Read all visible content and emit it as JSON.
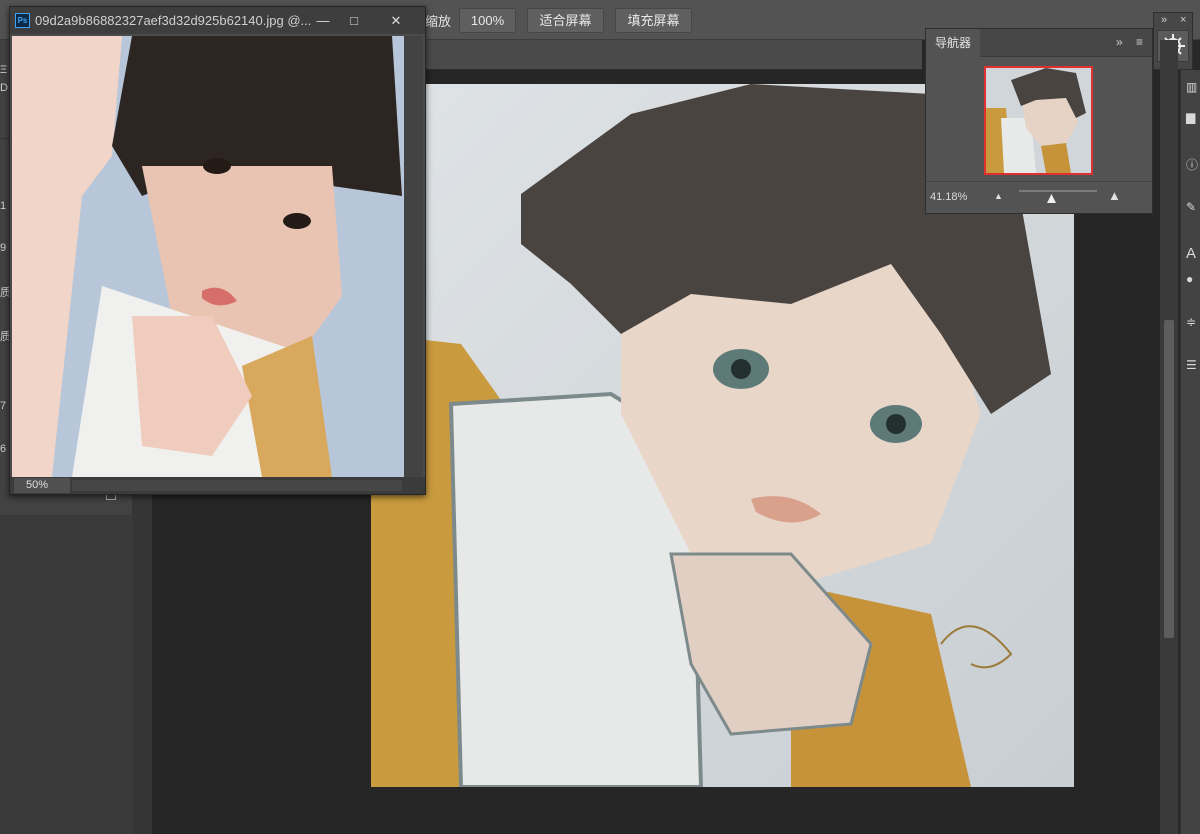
{
  "options_bar": {
    "zoom_label": "缩放",
    "btn_100": "100%",
    "btn_fit": "适合屏幕",
    "btn_fill": "填充屏幕"
  },
  "left_panel": {
    "rows": [
      "Ξ",
      "D",
      "1",
      "9",
      "质",
      "质",
      "7",
      "6"
    ]
  },
  "ref_window": {
    "app_icon": "Ps",
    "title": "09d2a9b86882327aef3d32d925b62140.jpg @...",
    "zoom": "50%"
  },
  "navigator": {
    "tab": "导航器",
    "collapse": "»",
    "menu": "≡",
    "zoom": "41.18%"
  },
  "right_panel": {
    "collapse": "»",
    "close": "×",
    "panel_icon": "navigator-wheel-icon"
  },
  "colors": {
    "ui_dark": "#282828",
    "ui_mid": "#535353",
    "accent_red": "#e03030",
    "ps_blue": "#3ea2f5"
  }
}
